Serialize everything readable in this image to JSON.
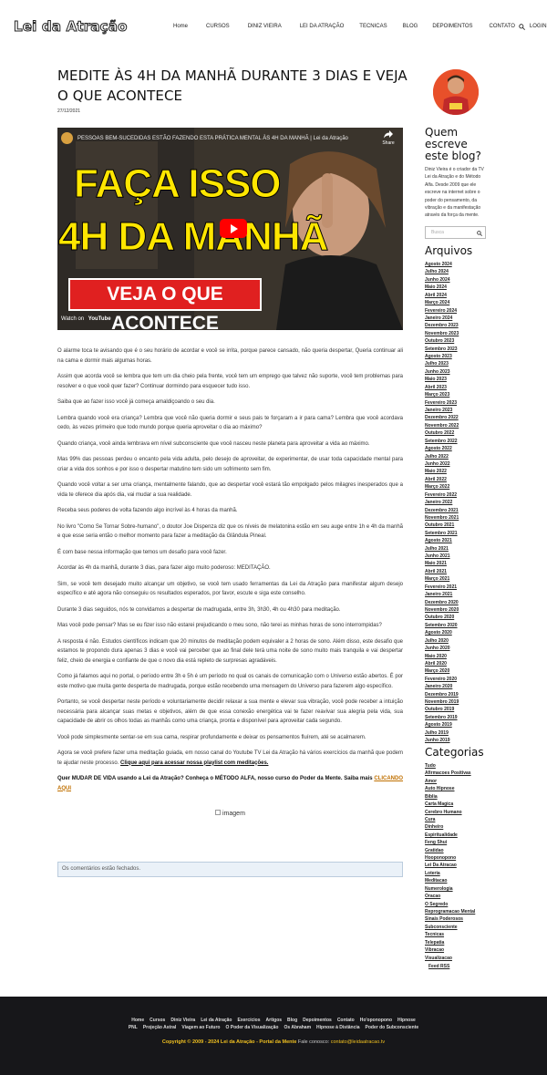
{
  "header": {
    "logo": "Lei da Atração",
    "nav": [
      "Home",
      "CURSOS",
      "DINIZ VIEIRA",
      "LEI DA ATRAÇÃO",
      "TECNICAS",
      "BLOG",
      "DEPOIMENTOS",
      "CONTATO",
      "LOGIN"
    ]
  },
  "post": {
    "title": "MEDITE ÀS 4H DA MANHÃ DURANTE 3 DIAS E VEJA O QUE ACONTECE",
    "date": "27/12/2021",
    "video": {
      "caption": "PESSOAS BEM-SUCEDIDAS ESTÃO FAZENDO ESTA PRÁTICA MENTAL ÀS 4H DA MANHÃ | Lei da Atração",
      "share": "Share",
      "line1": "FAÇA ISSO",
      "line2": "4H DA MANHÃ",
      "banner": "VEJA O QUE ACONTECE",
      "watch": "Watch on",
      "yt": "YouTube"
    },
    "paragraphs": [
      "O alarme toca te avisando que é o seu horário de acordar e você se irrita, porque parece cansado, não queria despertar, Queria continuar ali na cama e dormir mais algumas horas.",
      "Assim que acorda você se lembra que tem um dia cheio pela frente, você tem um emprego que talvez não suporte, você tem problemas para resolver e o que você quer fazer? Continuar dormindo para esquecer tudo isso.",
      "Saiba que ao fazer isso você já começa amaldiçoando o seu dia.",
      "Lembra quando você era criança? Lembra que você não queria dormir e seus pais te forçaram a ir para cama? Lembra que você acordava cedo, às vezes primeiro que todo mundo porque queria aproveitar o dia ao máximo?",
      "Quando criança, você ainda lembrava em nível subconsciente que você nasceu neste planeta para aproveitar a vida ao máximo.",
      "Mas 99% das pessoas perdeu o encanto pela vida adulta, pelo desejo de aproveitar, de experimentar, de usar toda capacidade mental para criar a vida dos sonhos e por isso o despertar matutino tem sido um sofrimento sem fim.",
      "Quando você voltar a ser uma criança, mentalmente falando, que ao despertar você estará tão empolgado pelos milagres inesperados que a vida te oferece dia após dia, vai mudar a sua realidade.",
      "Receba seus poderes de volta fazendo algo incrível às 4 horas da manhã.",
      "No livro \"Como Se Tornar Sobre-humano\", o doutor Joe Dispenza diz que os níveis de melatonina estão em seu auge entre 1h e 4h da manhã e que esse seria então o melhor momento para fazer a meditação da Glândula Pineal.",
      "É com base nessa informação que temos um desafio para você fazer.",
      "Acordar às 4h da manhã, durante 3 dias, para fazer algo muito poderoso: MEDITAÇÃO.",
      "Sim, se você tem desejado muito alcançar um objetivo, se você tem usado ferramentas da Lei da Atração para manifestar algum desejo específico e até agora não conseguiu os resultados esperados, por favor, escute e siga este conselho.",
      "Durante 3 dias seguidos, nós te convidamos a despertar de madrugada, entre 3h, 3h30, 4h ou 4h30 para meditação.",
      "Mas você pode pensar? Mas se eu fizer isso não estarei prejudicando o meu sono, não terei as minhas horas de sono interrompidas?",
      "A resposta é não. Estudos científicos indicam que 20 minutos de meditação podem equivaler a 2 horas de sono. Além disso, este desafio que estamos te propondo dura apenas 3 dias e você vai perceber que ao final dele terá uma noite de sono muito mais tranquila e vai despertar feliz, cheio de energia e confiante de que o novo dia está repleto de surpresas agradáveis.",
      "Como já falamos aqui no portal, o período entre 3h e 5h é um período no qual os canais de comunicação com o Universo estão abertos. É por este motivo que muita gente desperta de madrugada, porque estão recebendo uma mensagem do Universo para fazerem algo específico.",
      "Portanto, se você despertar neste período e voluntariamente decidir relaxar a sua mente e elevar sua vibração, você pode receber a intuição necessária para alcançar suas metas e objetivos, além de que essa conexão energética vai te fazer reavivar sua alegria pela vida, sua capacidade de abrir os olhos todas as manhãs como uma criança, pronta e disponível para aproveitar cada segundo.",
      "Você pode simplesmente sentar-se em sua cama, respirar profundamente e deixar os pensamentos fluírem, até se acalmarem."
    ],
    "last_para": "Agora se você prefere fazer uma meditação guiada, em nosso canal do Youtube TV Lei da Atração há vários exercícios da manhã que podem te ajudar neste processo.",
    "last_link": "Clique aqui para acessar nossa playlist com meditações.",
    "cta": "Quer MUDAR DE VIDA usando a Lei da Atração? Conheça o MÉTODO ALFA, nosso curso do Poder da Mente. Saiba mais",
    "cta_link": "CLICANDO AQUI",
    "image_alt": "imagem",
    "comments": "Os comentários estão fechados."
  },
  "sidebar": {
    "who_title": "Quem escreve este blog?",
    "who_text": "Diniz Vieira é o criador da TV Lei da Atração e do Método Alfa. Desde 2009 que ele escreve na internet sobre o poder do pensamento, da vibração e da manifestação através da força da mente.",
    "search_placeholder": "Busca",
    "archives_title": "Arquivos",
    "archives": [
      "Agosto 2024",
      "Julho 2024",
      "Junho 2024",
      "Maio 2024",
      "Abril 2024",
      "Março 2024",
      "Fevereiro 2024",
      "Janeiro 2024",
      "Dezembro 2023",
      "Novembro 2023",
      "Outubro 2023",
      "Setembro 2023",
      "Agosto 2023",
      "Julho 2023",
      "Junho 2023",
      "Maio 2023",
      "Abril 2023",
      "Março 2023",
      "Fevereiro 2023",
      "Janeiro 2023",
      "Dezembro 2022",
      "Novembro 2022",
      "Outubro 2022",
      "Setembro 2022",
      "Agosto 2022",
      "Julho 2022",
      "Junho 2022",
      "Maio 2022",
      "Abril 2022",
      "Março 2022",
      "Fevereiro 2022",
      "Janeiro 2022",
      "Dezembro 2021",
      "Novembro 2021",
      "Outubro 2021",
      "Setembro 2021",
      "Agosto 2021",
      "Julho 2021",
      "Junho 2021",
      "Maio 2021",
      "Abril 2021",
      "Março 2021",
      "Fevereiro 2021",
      "Janeiro 2021",
      "Dezembro 2020",
      "Novembro 2020",
      "Outubro 2020",
      "Setembro 2020",
      "Agosto 2020",
      "Julho 2020",
      "Junho 2020",
      "Maio 2020",
      "Abril 2020",
      "Março 2020",
      "Fevereiro 2020",
      "Janeiro 2020",
      "Dezembro 2019",
      "Novembro 2019",
      "Outubro 2019",
      "Setembro 2019",
      "Agosto 2019",
      "Julho 2019",
      "Junho 2019"
    ],
    "categories_title": "Categorias",
    "categories": [
      "Tudo",
      "Afirmacoes Positivas",
      "Amor",
      "Auto Hipnose",
      "Bíblia",
      "Carta Magica",
      "Cerebro Humano",
      "Cura",
      "Dinheiro",
      "Espiritualidade",
      "Feng Shui",
      "Gratidao",
      "Hooponopono",
      "Lei Da Atracao",
      "Loteria",
      "Meditacao",
      "Numerologia",
      "Oracao",
      "O Segredo",
      "Reprogramacao Mental",
      "Sinais Poderosos",
      "Subconsciente",
      "Tecnicas",
      "Telepatia",
      "Vibracao",
      "Visualizacao"
    ],
    "feed": "Feed RSS"
  },
  "footer": {
    "row1": [
      "Home",
      "Cursos",
      "Diniz Vieira",
      "Lei da Atração",
      "Exercícios",
      "Artigos",
      "Blog",
      "Depoimentos",
      "Contato",
      "Ho'oponopono",
      "Hipnose"
    ],
    "row2": [
      "PNL",
      "Projeção Astral",
      "Viagem ao Futuro",
      "O Poder da Visualização",
      "Os Abraham",
      "Hipnose à Distância",
      "Poder do Subconsciente"
    ],
    "copyright": "Copyright © 2009 - 2024 Lei da Atração - Portal da Mente",
    "contact_label": "Fale conosco:",
    "email": "contato@leidaatracao.tv"
  },
  "colors": {
    "accent": "#f0c020",
    "footer_bg": "#17171a",
    "video_red": "#e02020",
    "video_yellow": "#ffe600"
  }
}
